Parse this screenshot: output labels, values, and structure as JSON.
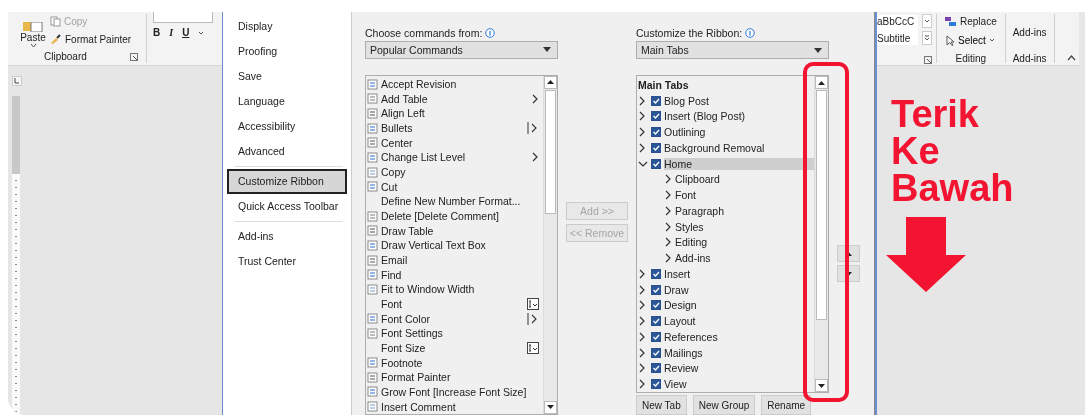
{
  "word_ribbon_left": {
    "paste": "Paste",
    "copy": {
      "label": "Copy",
      "disabled": true
    },
    "format_painter": "Format Painter",
    "group_label": "Clipboard",
    "font_buttons": [
      "B",
      "I",
      "U"
    ]
  },
  "options_nav": {
    "items": [
      {
        "label": "Display",
        "selected": false,
        "divider_after": false
      },
      {
        "label": "Proofing",
        "selected": false,
        "divider_after": false
      },
      {
        "label": "Save",
        "selected": false,
        "divider_after": false
      },
      {
        "label": "Language",
        "selected": false,
        "divider_after": false
      },
      {
        "label": "Accessibility",
        "selected": false,
        "divider_after": false
      },
      {
        "label": "Advanced",
        "selected": false,
        "divider_after": true
      },
      {
        "label": "Customize Ribbon",
        "selected": true,
        "divider_after": false
      },
      {
        "label": "Quick Access Toolbar",
        "selected": false,
        "divider_after": true
      },
      {
        "label": "Add-ins",
        "selected": false,
        "divider_after": false
      },
      {
        "label": "Trust Center",
        "selected": false,
        "divider_after": false
      }
    ]
  },
  "commands": {
    "label": "Choose commands from:",
    "dropdown": "Popular Commands",
    "items": [
      {
        "label": "Accept Revision",
        "icon": true,
        "kind": "plain"
      },
      {
        "label": "Add Table",
        "icon": true,
        "kind": "submenu"
      },
      {
        "label": "Align Left",
        "icon": true,
        "kind": "plain"
      },
      {
        "label": "Bullets",
        "icon": true,
        "kind": "split"
      },
      {
        "label": "Center",
        "icon": true,
        "kind": "plain"
      },
      {
        "label": "Change List Level",
        "icon": true,
        "kind": "submenu"
      },
      {
        "label": "Copy",
        "icon": true,
        "kind": "plain"
      },
      {
        "label": "Cut",
        "icon": true,
        "kind": "plain"
      },
      {
        "label": "Define New Number Format...",
        "icon": false,
        "kind": "plain"
      },
      {
        "label": "Delete [Delete Comment]",
        "icon": true,
        "kind": "plain"
      },
      {
        "label": "Draw Table",
        "icon": true,
        "kind": "plain"
      },
      {
        "label": "Draw Vertical Text Box",
        "icon": true,
        "kind": "plain"
      },
      {
        "label": "Email",
        "icon": true,
        "kind": "plain"
      },
      {
        "label": "Find",
        "icon": true,
        "kind": "plain"
      },
      {
        "label": "Fit to Window Width",
        "icon": true,
        "kind": "plain"
      },
      {
        "label": "Font",
        "icon": false,
        "kind": "field"
      },
      {
        "label": "Font Color",
        "icon": true,
        "kind": "split"
      },
      {
        "label": "Font Settings",
        "icon": true,
        "kind": "plain"
      },
      {
        "label": "Font Size",
        "icon": false,
        "kind": "field"
      },
      {
        "label": "Footnote",
        "icon": true,
        "kind": "plain"
      },
      {
        "label": "Format Painter",
        "icon": true,
        "kind": "plain"
      },
      {
        "label": "Grow Font [Increase Font Size]",
        "icon": true,
        "kind": "plain"
      },
      {
        "label": "Insert Comment",
        "icon": true,
        "kind": "plain"
      }
    ]
  },
  "add_button": {
    "label": "Add >>",
    "disabled": true
  },
  "remove_button": {
    "label": "<< Remove",
    "disabled": true
  },
  "ribbon_tabs": {
    "label": "Customize the Ribbon:",
    "dropdown": "Main Tabs",
    "header": "Main Tabs",
    "items": [
      {
        "label": "Blog Post",
        "checked": true,
        "expanded": false,
        "selected": false
      },
      {
        "label": "Insert (Blog Post)",
        "checked": true,
        "expanded": false,
        "selected": false
      },
      {
        "label": "Outlining",
        "checked": true,
        "expanded": false,
        "selected": false
      },
      {
        "label": "Background Removal",
        "checked": true,
        "expanded": false,
        "selected": false
      },
      {
        "label": "Home",
        "checked": true,
        "expanded": true,
        "selected": true,
        "children": [
          {
            "label": "Clipboard",
            "expanded": false
          },
          {
            "label": "Font",
            "expanded": false
          },
          {
            "label": "Paragraph",
            "expanded": false
          },
          {
            "label": "Styles",
            "expanded": false
          },
          {
            "label": "Editing",
            "expanded": false
          },
          {
            "label": "Add-ins",
            "expanded": false
          }
        ]
      },
      {
        "label": "Insert",
        "checked": true,
        "expanded": false,
        "selected": false
      },
      {
        "label": "Draw",
        "checked": true,
        "expanded": false,
        "selected": false
      },
      {
        "label": "Design",
        "checked": true,
        "expanded": false,
        "selected": false
      },
      {
        "label": "Layout",
        "checked": true,
        "expanded": false,
        "selected": false
      },
      {
        "label": "References",
        "checked": true,
        "expanded": false,
        "selected": false
      },
      {
        "label": "Mailings",
        "checked": true,
        "expanded": false,
        "selected": false
      },
      {
        "label": "Review",
        "checked": true,
        "expanded": false,
        "selected": false
      },
      {
        "label": "View",
        "checked": true,
        "expanded": false,
        "selected": false
      }
    ]
  },
  "tree_buttons": [
    "New Tab",
    "New Group",
    "Rename"
  ],
  "word_ribbon_right": {
    "style_preview": "aBbCcC",
    "style_name": "Subtitle",
    "replace": "Replace",
    "select": "Select",
    "editing_label": "Editing",
    "addins_button": "Add-ins",
    "addins_label": "Add-ins"
  },
  "annotation": {
    "lines": [
      "Terik",
      "Ke",
      "Bawah"
    ]
  }
}
